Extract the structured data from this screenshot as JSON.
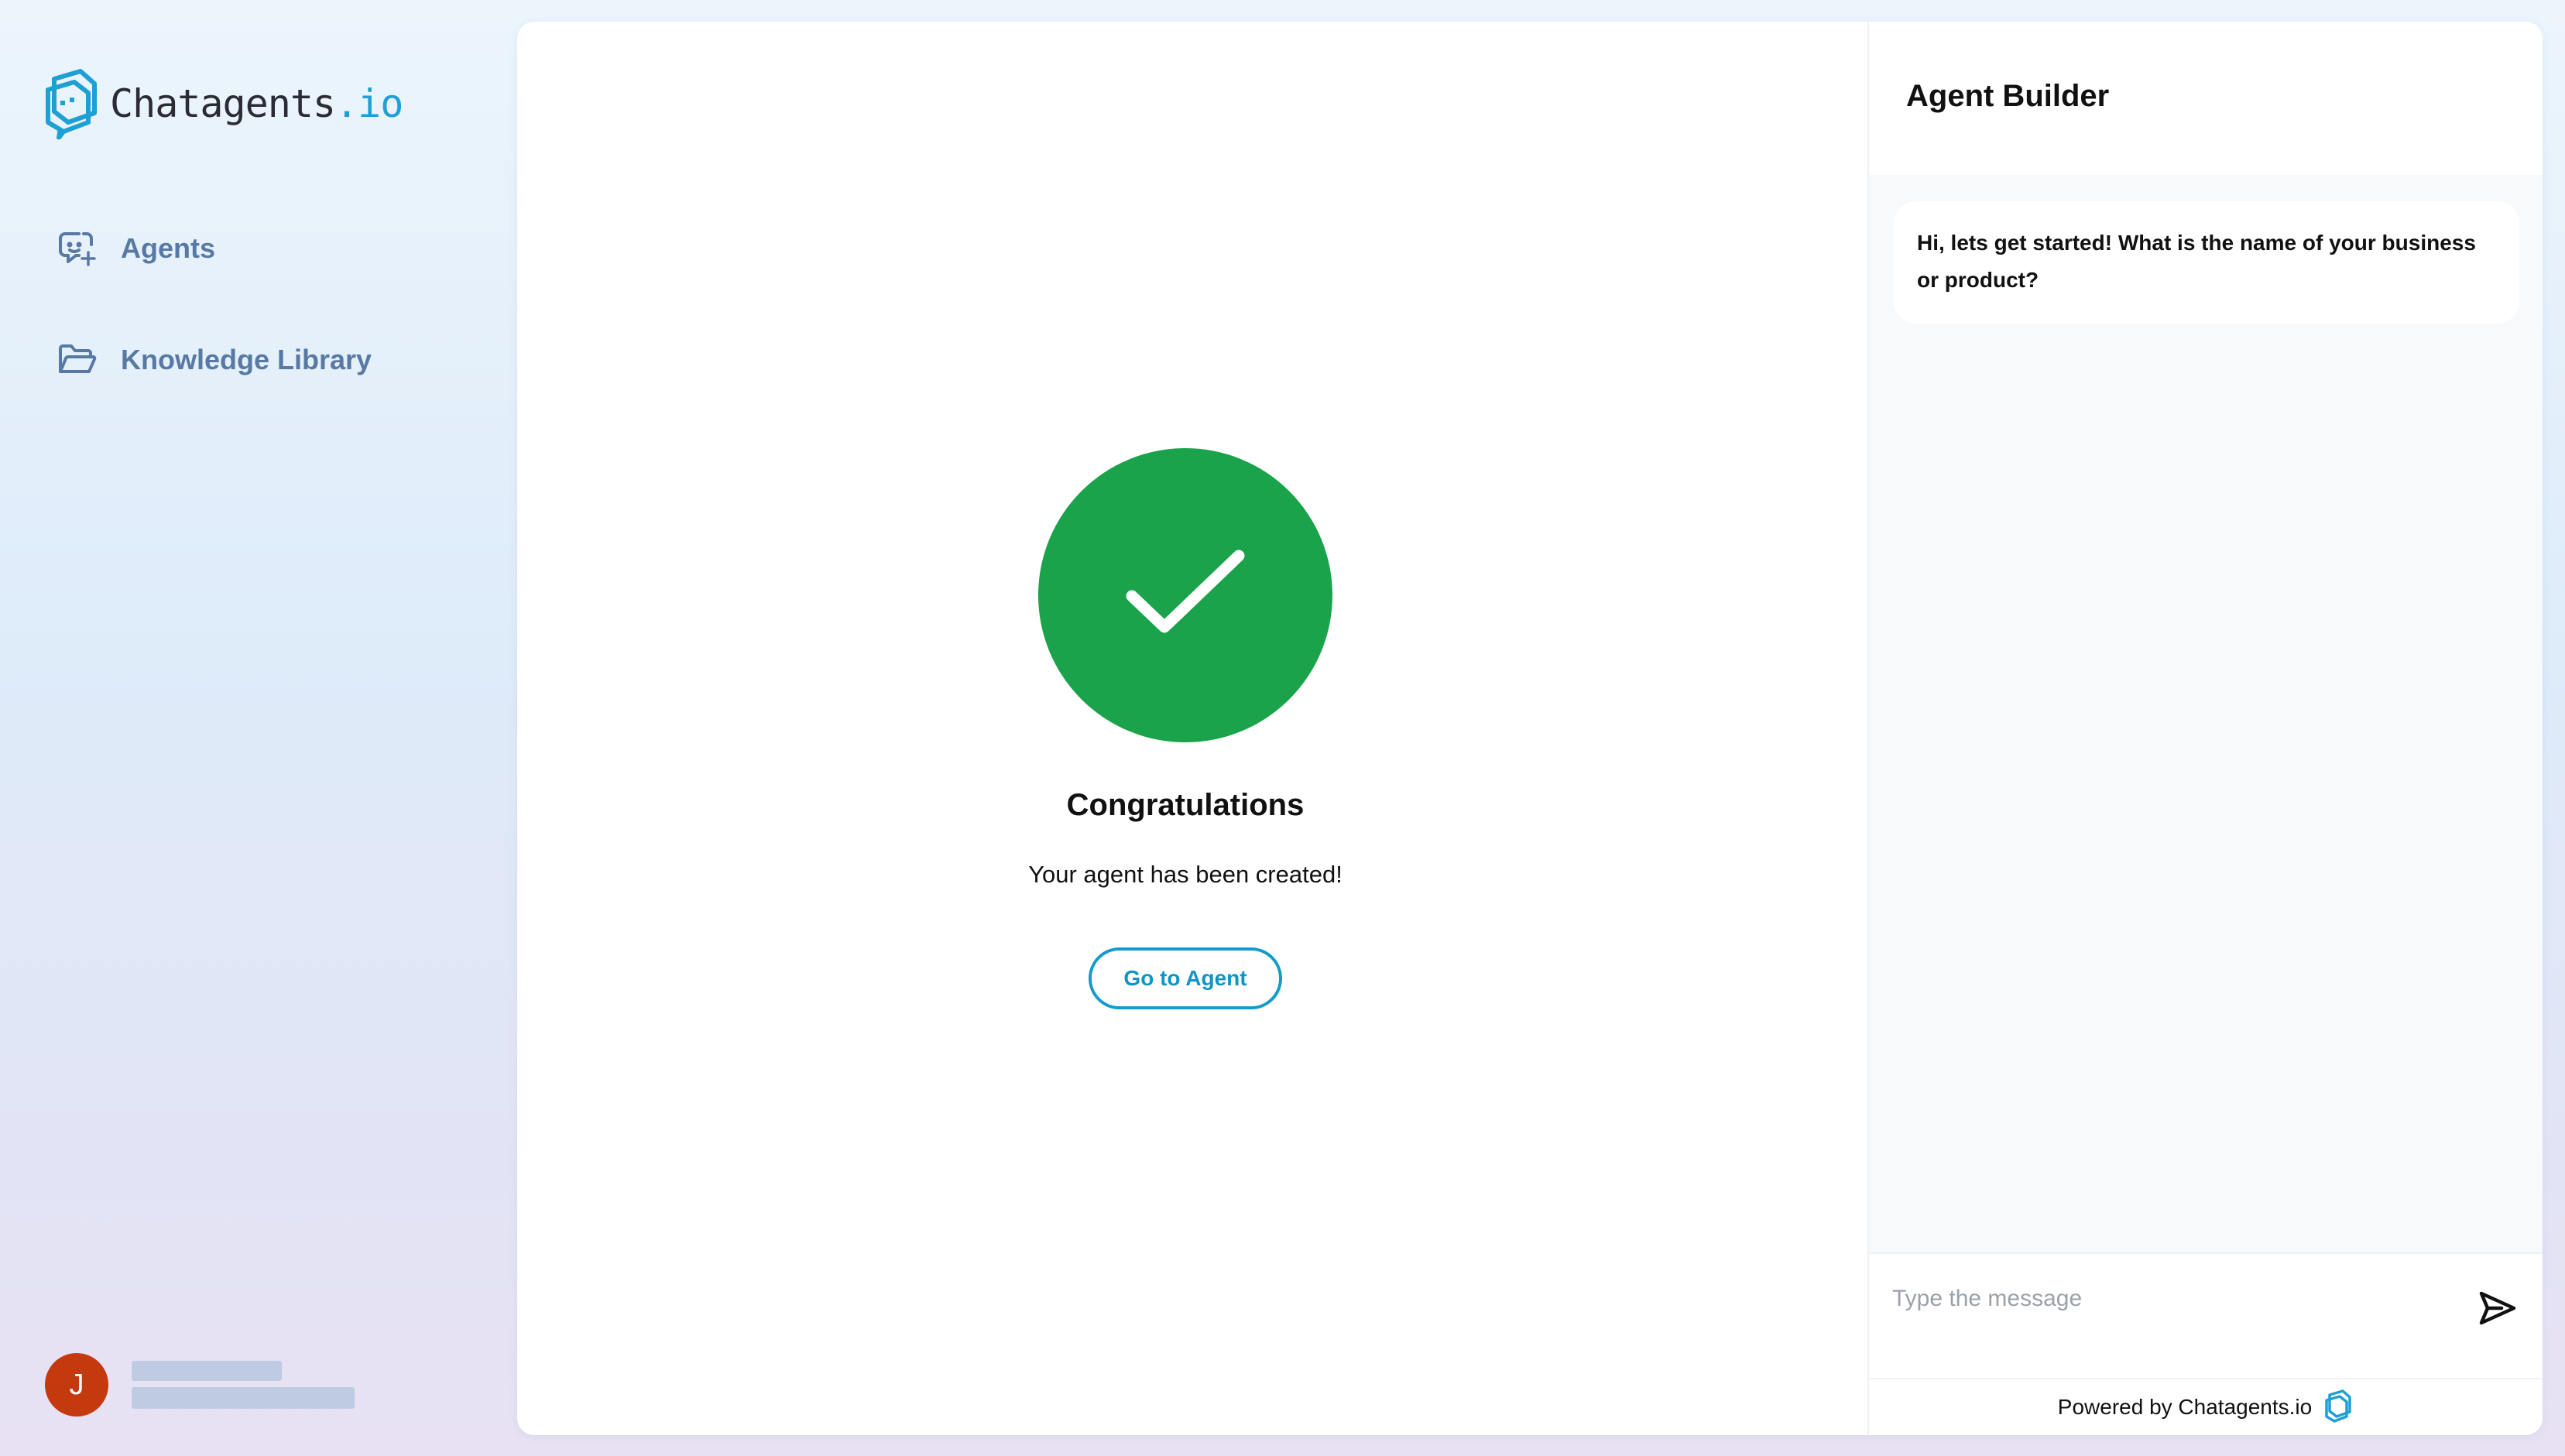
{
  "brand": {
    "name_main": "Chatagents",
    "name_suffix": ".io",
    "accent_color": "#1ea0d4"
  },
  "sidebar": {
    "items": [
      {
        "label": "Agents",
        "icon": "robot-sparkle-icon"
      },
      {
        "label": "Knowledge Library",
        "icon": "folder-open-icon"
      }
    ],
    "user": {
      "avatar_initial": "J"
    }
  },
  "main": {
    "success_icon": "checkmark-icon",
    "success_color": "#1aa34a",
    "title": "Congratulations",
    "subtitle": "Your agent has been created!",
    "button_label": "Go to Agent"
  },
  "builder": {
    "title": "Agent Builder",
    "messages": [
      {
        "role": "bot",
        "text": "Hi, lets get started! What is the name of your business or product?"
      }
    ],
    "input_placeholder": "Type the message",
    "send_icon": "send-icon",
    "powered_by": "Powered by Chatagents.io"
  }
}
